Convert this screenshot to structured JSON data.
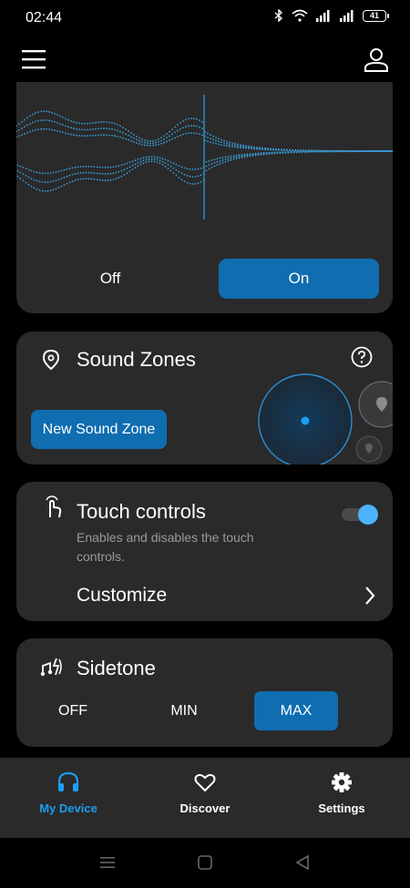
{
  "status": {
    "time": "02:44",
    "battery": "41"
  },
  "wave_toggle": {
    "off_label": "Off",
    "on_label": "On",
    "selected": "On"
  },
  "sound_zones": {
    "title": "Sound Zones",
    "new_zone_label": "New Sound Zone"
  },
  "touch_controls": {
    "title": "Touch controls",
    "description": "Enables and disables the touch controls.",
    "enabled": true,
    "customize_label": "Customize"
  },
  "sidetone": {
    "title": "Sidetone",
    "options": [
      "OFF",
      "MIN",
      "MAX"
    ],
    "selected": "MAX"
  },
  "bottom_nav": {
    "items": [
      {
        "label": "My Device",
        "icon": "headphones-icon",
        "active": true
      },
      {
        "label": "Discover",
        "icon": "heart-icon",
        "active": false
      },
      {
        "label": "Settings",
        "icon": "gear-icon",
        "active": false
      }
    ]
  },
  "colors": {
    "accent": "#0f6db0",
    "accent_light": "#1a9ff0",
    "card": "#2a2a2b",
    "background": "#000000"
  }
}
